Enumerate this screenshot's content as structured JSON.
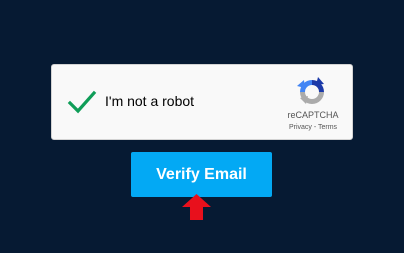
{
  "captcha": {
    "label": "I'm not a robot",
    "checked": true,
    "brand": "reCAPTCHA",
    "privacy_link": "Privacy",
    "separator": " - ",
    "terms_link": "Terms",
    "check_icon": "check-icon",
    "logo_icon": "recaptcha-logo-icon"
  },
  "verify_button": {
    "label": "Verify Email",
    "color": "#03a9f4"
  },
  "pointer": {
    "icon": "arrow-up-icon",
    "color": "#e8101c"
  },
  "colors": {
    "background": "#061a33",
    "check": "#0f9d58"
  }
}
